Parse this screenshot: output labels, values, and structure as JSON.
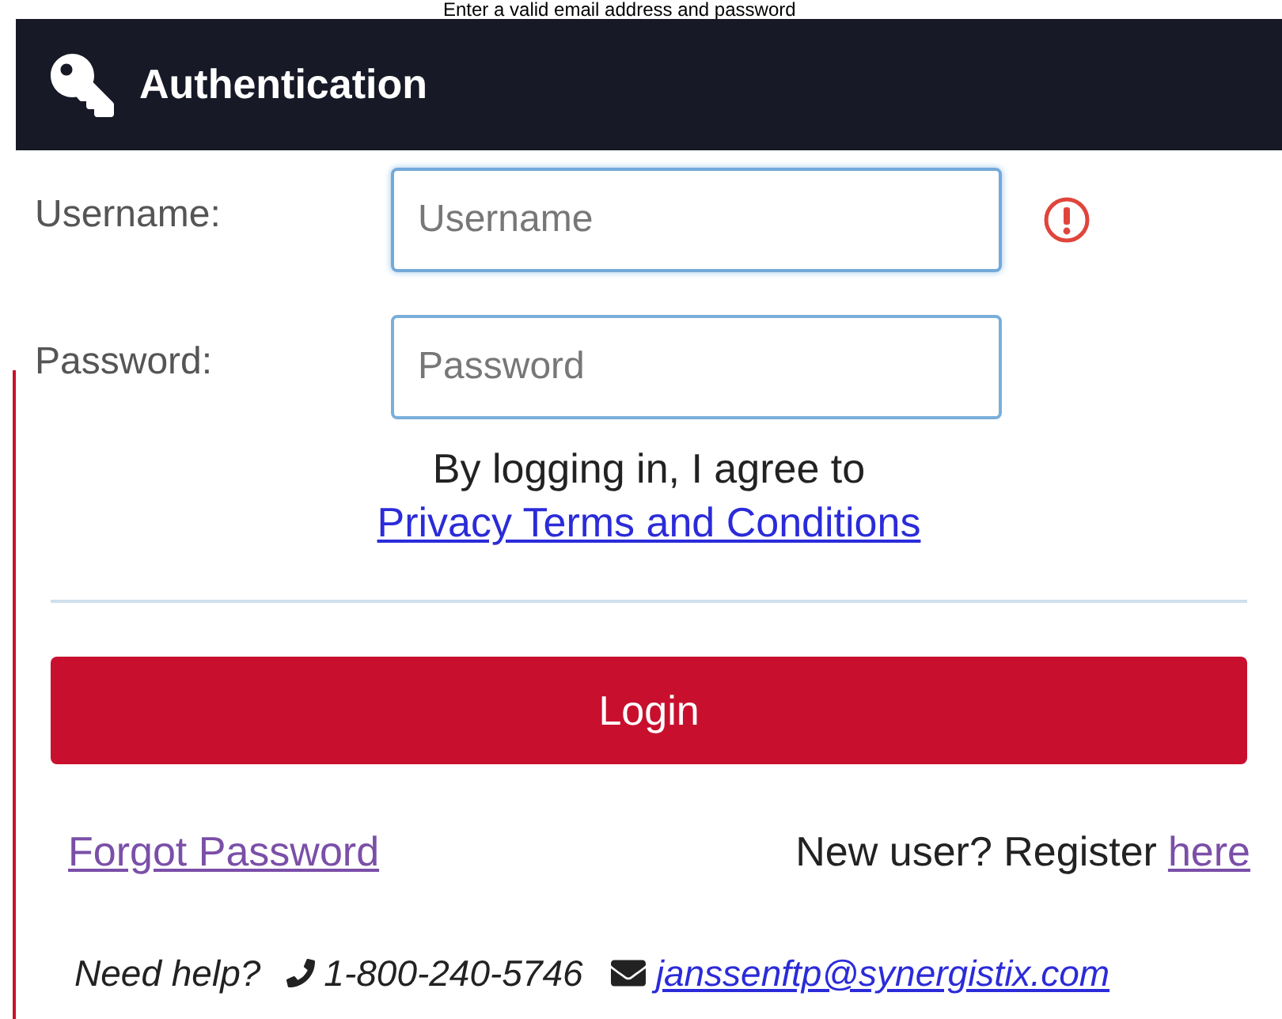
{
  "note": "Enter a valid email address and password",
  "header": {
    "title": "Authentication"
  },
  "fields": [
    {
      "label": "Username:",
      "placeholder": "Username",
      "focused": true,
      "error": true
    },
    {
      "label": "Password:",
      "placeholder": "Password",
      "focused": false,
      "error": false
    }
  ],
  "agreement": {
    "text": "By logging in, I agree to",
    "link": "Privacy Terms and Conditions"
  },
  "login_button": "Login",
  "forgot_link": "Forgot Password",
  "register": {
    "text": "New user? Register",
    "link": "here"
  },
  "help": {
    "text": "Need help?",
    "phone": "1-800-240-5746",
    "email": "janssenftp@synergistix.com"
  }
}
